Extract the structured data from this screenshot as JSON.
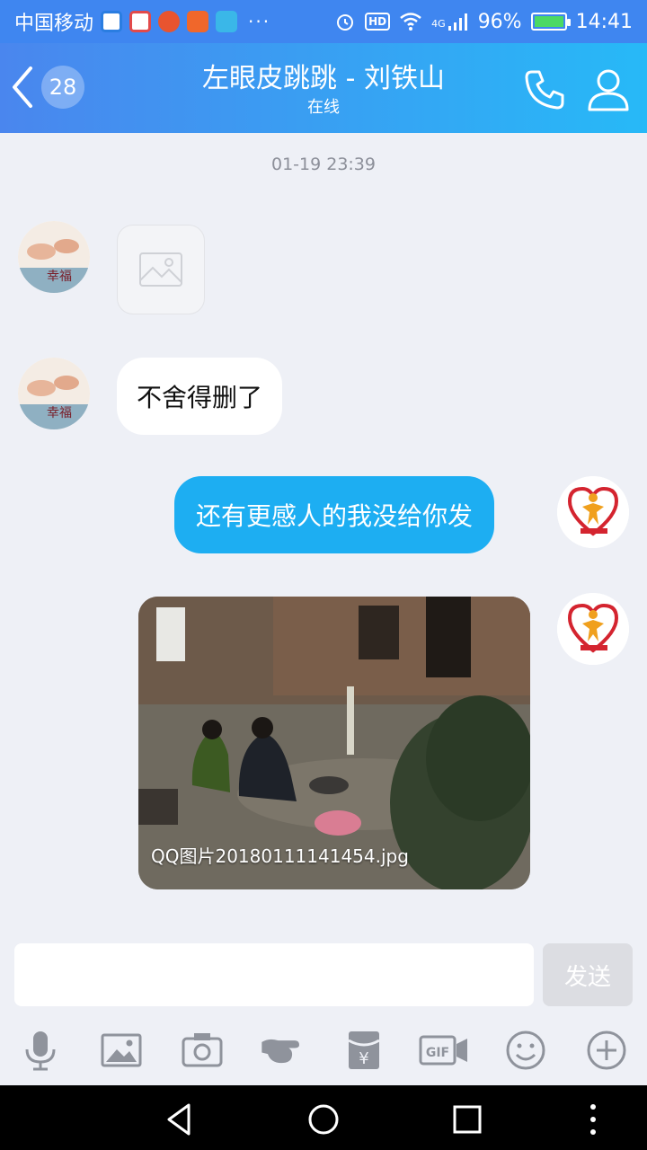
{
  "status_bar": {
    "carrier": "中国移动",
    "dots": "···",
    "hd": "HD",
    "network": "4G",
    "battery": "96%",
    "time": "14:41"
  },
  "header": {
    "unread_count": "28",
    "title": "左眼皮跳跳 - 刘铁山",
    "subtitle": "在线"
  },
  "chat": {
    "timestamp": "01-19 23:39",
    "messages": [
      {
        "side": "left",
        "type": "image-placeholder"
      },
      {
        "side": "left",
        "type": "text",
        "text": "不舍得删了"
      },
      {
        "side": "right",
        "type": "text",
        "text": "还有更感人的我没给你发"
      },
      {
        "side": "right",
        "type": "image",
        "caption": "QQ图片20180111141454.jpg"
      }
    ],
    "left_avatar_text": "幸福"
  },
  "input": {
    "value": "",
    "send_label": "发送"
  },
  "toolbar": {
    "items": [
      "voice",
      "image",
      "camera",
      "poke",
      "red-packet",
      "gif",
      "emoji",
      "more"
    ],
    "gif_label": "GIF",
    "red_packet_symbol": "¥"
  },
  "colors": {
    "header_start": "#4a86ee",
    "header_end": "#27b9f7",
    "bubble_sent": "#1daef2",
    "bubble_received": "#ffffff",
    "background": "#eef0f6"
  }
}
